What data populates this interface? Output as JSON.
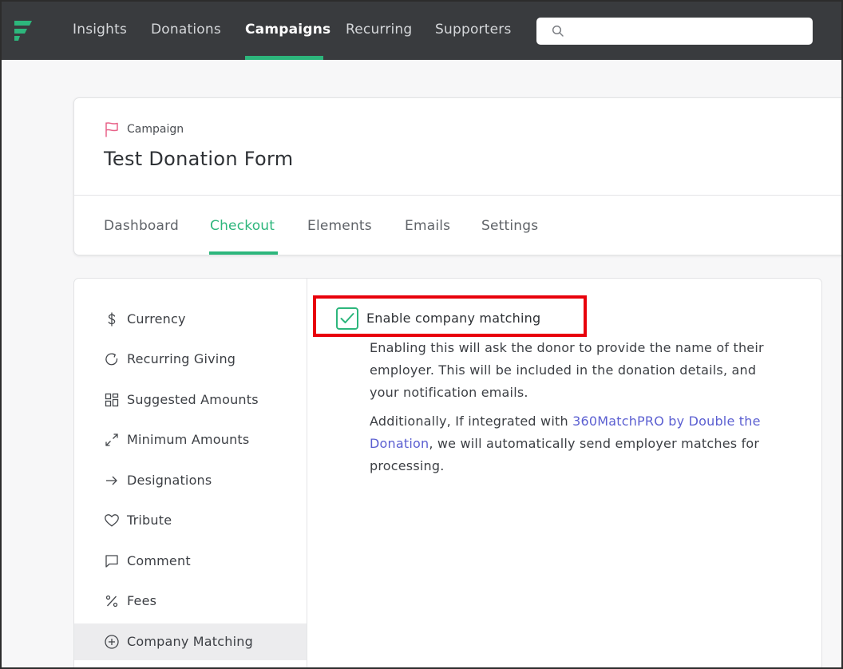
{
  "colors": {
    "accent": "#2db67c",
    "nav_bg": "#393b3e",
    "link": "#5b5fd1",
    "highlight": "#e8000b"
  },
  "topnav": {
    "logo_icon": "fundraise-logo-icon",
    "items": [
      {
        "label": "Insights"
      },
      {
        "label": "Donations"
      },
      {
        "label": "Campaigns"
      },
      {
        "label": "Recurring"
      },
      {
        "label": "Supporters"
      }
    ],
    "active_item": "Campaigns",
    "search": {
      "icon": "search-icon",
      "value": "",
      "placeholder": ""
    }
  },
  "header": {
    "crumb_icon": "flag-icon",
    "crumb": "Campaign",
    "title": "Test Donation Form",
    "tabs": [
      {
        "label": "Dashboard"
      },
      {
        "label": "Checkout"
      },
      {
        "label": "Elements"
      },
      {
        "label": "Emails"
      },
      {
        "label": "Settings"
      }
    ],
    "active_tab": "Checkout"
  },
  "sidebar": {
    "items": [
      {
        "label": "Currency",
        "icon": "dollar-icon"
      },
      {
        "label": "Recurring Giving",
        "icon": "refresh-icon"
      },
      {
        "label": "Suggested Amounts",
        "icon": "grid-icon"
      },
      {
        "label": "Minimum Amounts",
        "icon": "expand-icon"
      },
      {
        "label": "Designations",
        "icon": "arrow-right-icon"
      },
      {
        "label": "Tribute",
        "icon": "heart-icon"
      },
      {
        "label": "Comment",
        "icon": "comment-icon"
      },
      {
        "label": "Fees",
        "icon": "percent-icon"
      },
      {
        "label": "Company Matching",
        "icon": "plus-circle-icon"
      }
    ],
    "active_item": "Company Matching"
  },
  "content": {
    "checkbox_label": "Enable company matching",
    "checkbox_checked": true,
    "description": "Enabling this will ask the donor to provide the name of their employer. This will be included in the donation details, and your notification emails.",
    "additional_prefix": "Additionally, If integrated with ",
    "additional_link": "360MatchPRO by Double the Donation",
    "additional_suffix": ", we will automatically send employer matches for processing."
  }
}
